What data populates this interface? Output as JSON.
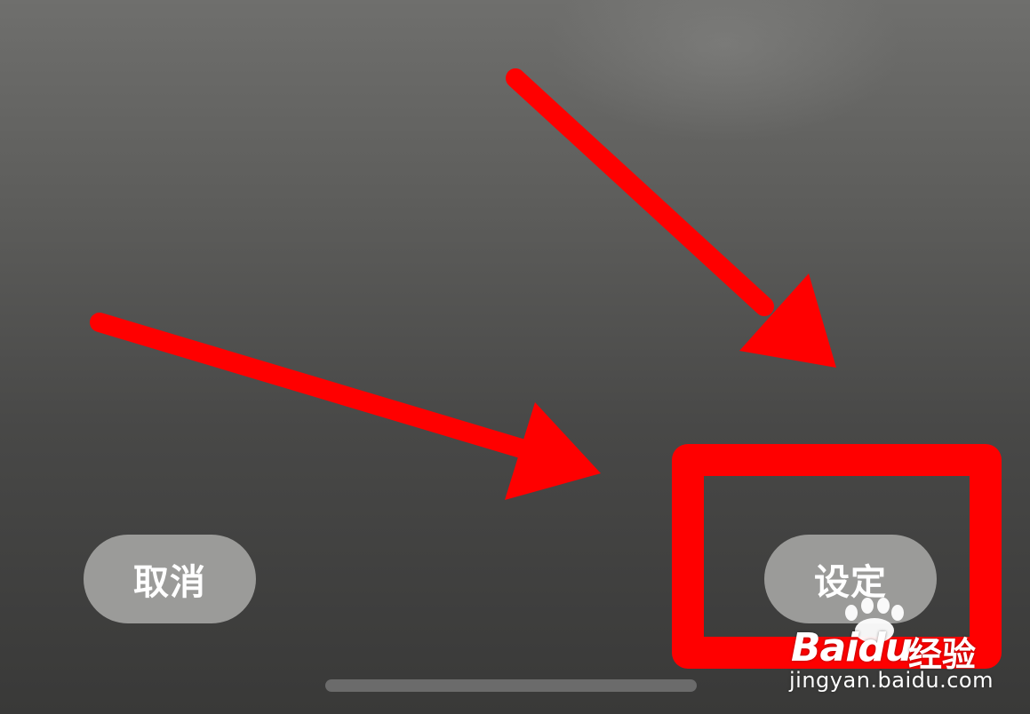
{
  "dialog": {
    "cancel_label": "取消",
    "confirm_label": "设定"
  },
  "annotation": {
    "arrow_color": "#ff0000",
    "highlight_color": "#ff0000"
  },
  "watermark": {
    "brand_text": "Baidu",
    "brand_cn": "经验",
    "url": "jingyan.baidu.com"
  },
  "colors": {
    "button_bg": "#9b9b99",
    "button_text": "#ffffff",
    "home_indicator": "#6b6b6b"
  }
}
